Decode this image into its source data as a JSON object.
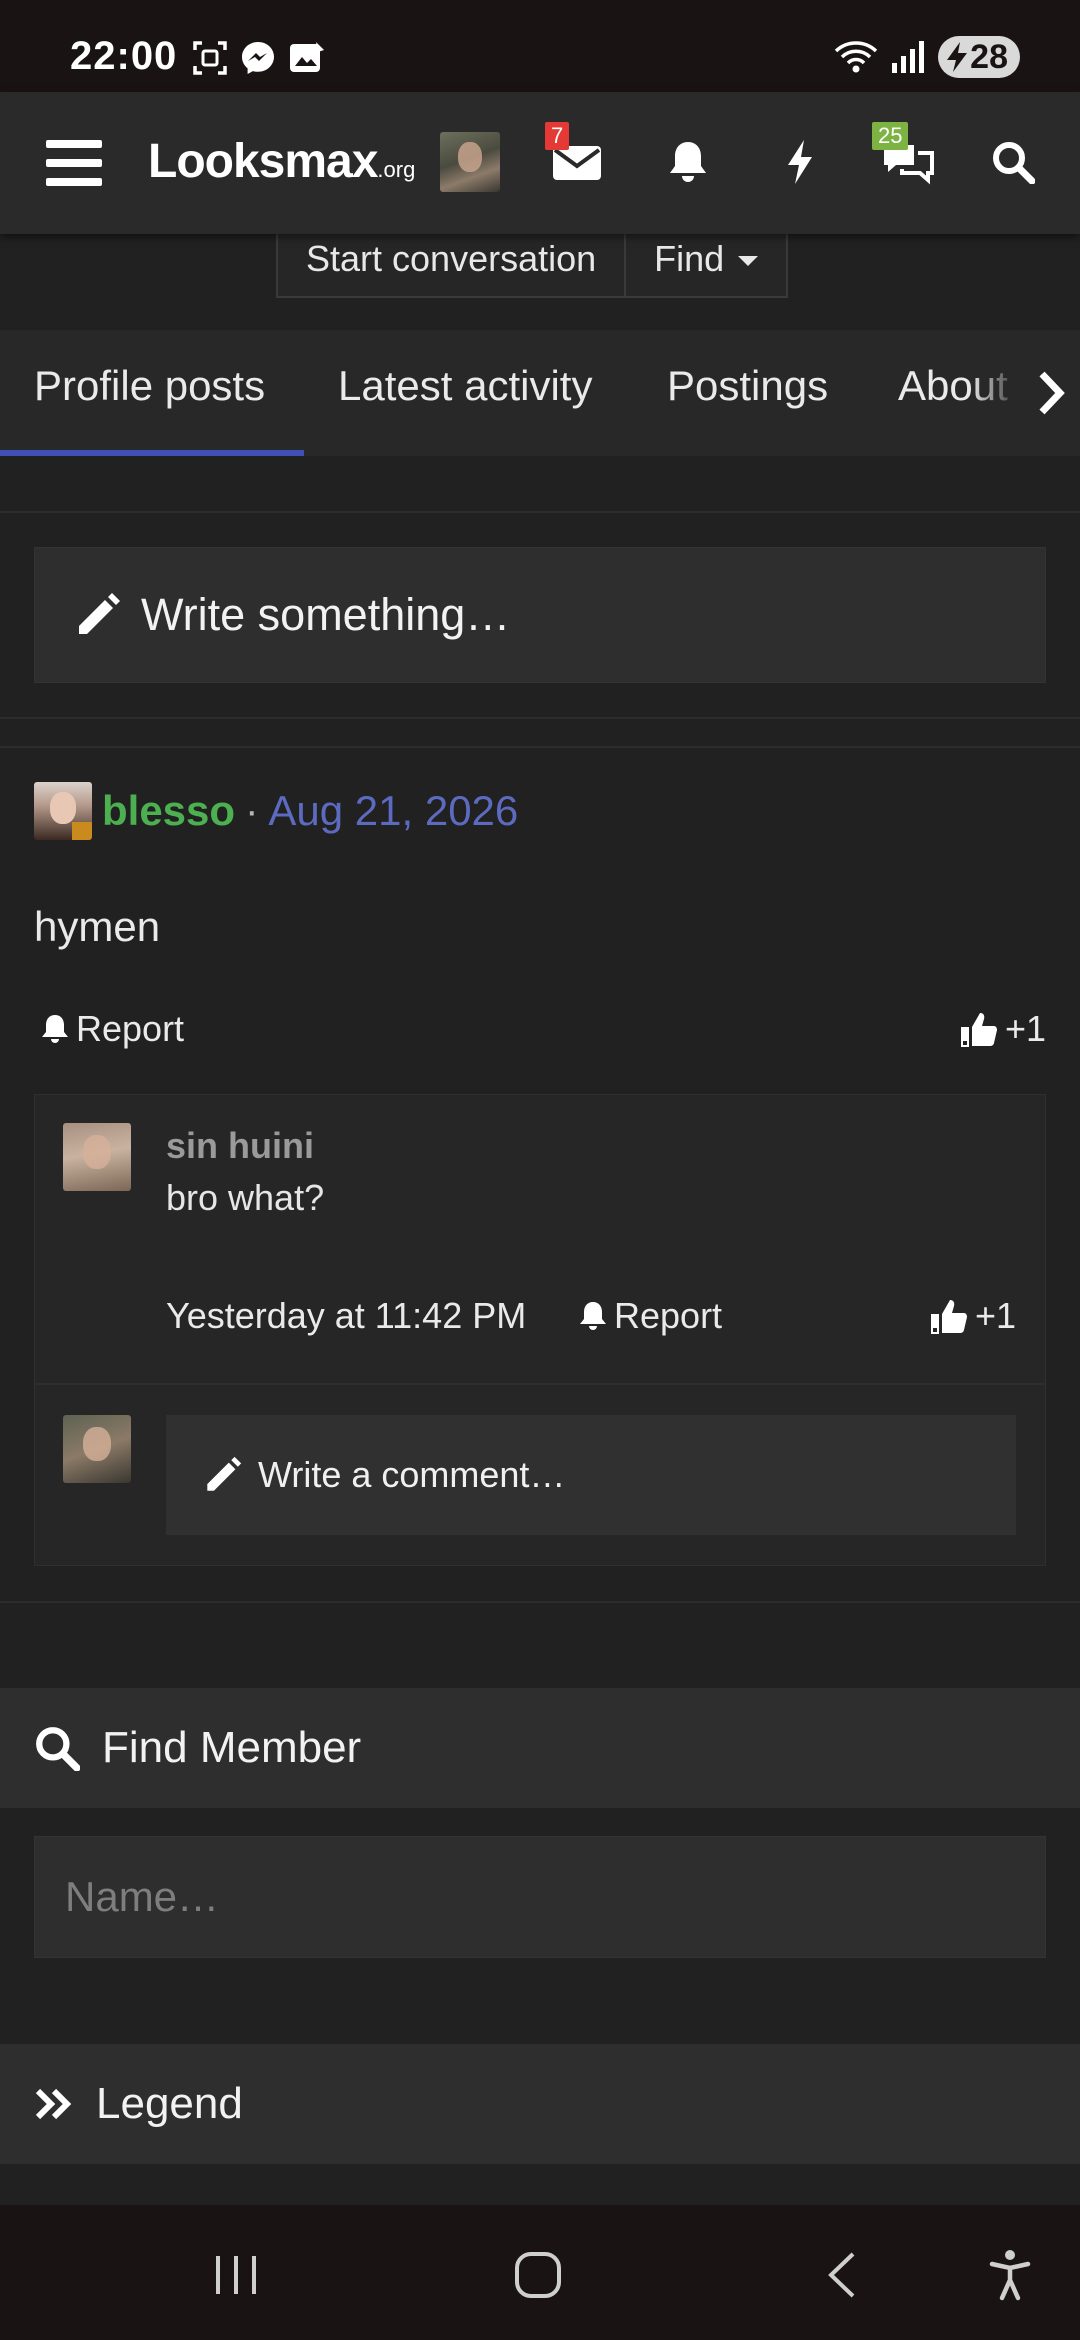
{
  "status_bar": {
    "time": "22:00",
    "battery": "28",
    "icons": [
      "screenshot-icon",
      "messenger-icon",
      "gallery-icon",
      "wifi-icon",
      "signal-icon",
      "battery-icon"
    ]
  },
  "header": {
    "logo": "Looksmax",
    "logo_suffix": ".org",
    "inbox_badge": "7",
    "alerts_badge": "25",
    "colors": {
      "inbox_badge": "#e53935",
      "alerts_badge": "#7cb342",
      "accent": "#3f51b5"
    }
  },
  "submenu": {
    "start_conversation": "Start conversation",
    "find": "Find"
  },
  "tabs": [
    {
      "label": "Profile posts",
      "active": true
    },
    {
      "label": "Latest activity"
    },
    {
      "label": "Postings"
    },
    {
      "label": "About"
    }
  ],
  "write_something": "Write something…",
  "post": {
    "user": "blesso",
    "separator": "·",
    "date": "Aug 21, 2026",
    "body": "hymen",
    "report": "Report",
    "reaction": "+1",
    "user_color": "#4caf50",
    "date_color": "#5c6bc0"
  },
  "comment": {
    "user": "sin huini",
    "text": "bro what?",
    "time": "Yesterday at 11:42 PM",
    "report": "Report",
    "reaction": "+1"
  },
  "write_comment": "Write a comment…",
  "find_member": {
    "title": "Find Member",
    "placeholder": "Name…"
  },
  "legend": {
    "title": "Legend"
  }
}
